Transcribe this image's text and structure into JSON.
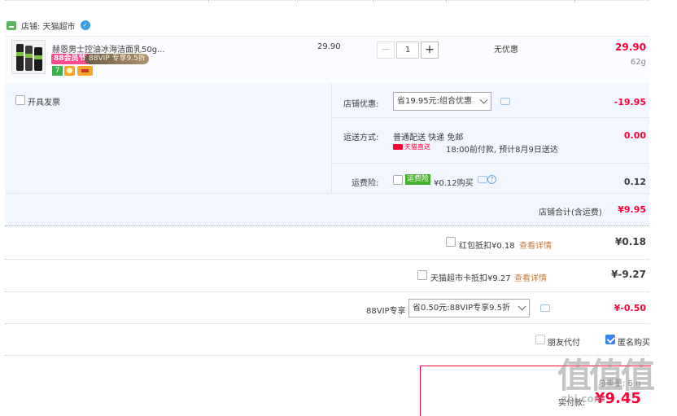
{
  "store": {
    "label": "店铺: 天猫超市"
  },
  "item": {
    "title": "赫恩男士控油冰海洁面乳50g...",
    "tag_88": "88会员节",
    "tag_vip": "88VIP  专享9.5折",
    "unit_price": "29.90",
    "quantity": "1",
    "minus": "−",
    "plus": "+",
    "discount": "无优惠",
    "subtotal": "29.90",
    "weight": "62g",
    "icon7": "7"
  },
  "invoice": {
    "label": "开具发票"
  },
  "shop_coupon": {
    "label": "店铺优惠:",
    "selected": "省19.95元:组合优惠",
    "amount": "-19.95"
  },
  "shipping": {
    "label": "运送方式:",
    "method": "普通配送 快递 免邮",
    "tag": "天猫直送",
    "eta": "18:00前付款, 预计8月9日送达",
    "amount": "0.00"
  },
  "insurance": {
    "label": "运费险:",
    "badge": "运费险",
    "price": "¥0.12购买",
    "amount": "0.12",
    "q": "?"
  },
  "shop_total": {
    "label": "店铺合计(含运费)",
    "amount": "¥9.95"
  },
  "red_packet": {
    "label": "红包抵扣¥0.18",
    "link": "查看详情",
    "amount": "¥0.18"
  },
  "market_card": {
    "label": "天猫超市卡抵扣¥9.27",
    "link": "查看详情",
    "amount": "¥-9.27"
  },
  "vip": {
    "label": "88VIP专享",
    "selected": "省0.50元:88VIP专享9.5折",
    "amount": "¥-0.50"
  },
  "friend_pay": {
    "label": "朋友代付"
  },
  "anonymous": {
    "label": "匿名购买"
  },
  "summary": {
    "weight": "总重量: 6 g",
    "pay_label": "实付款:",
    "pay_amount": "¥9.45"
  },
  "watermark": {
    "text": "值值值",
    "sub": "zhi.com"
  },
  "colors": {
    "price_red": "#ff0036",
    "panel_bg": "#f2f7ff",
    "link": "#c17b3b",
    "check_blue": "#3b82f0"
  }
}
